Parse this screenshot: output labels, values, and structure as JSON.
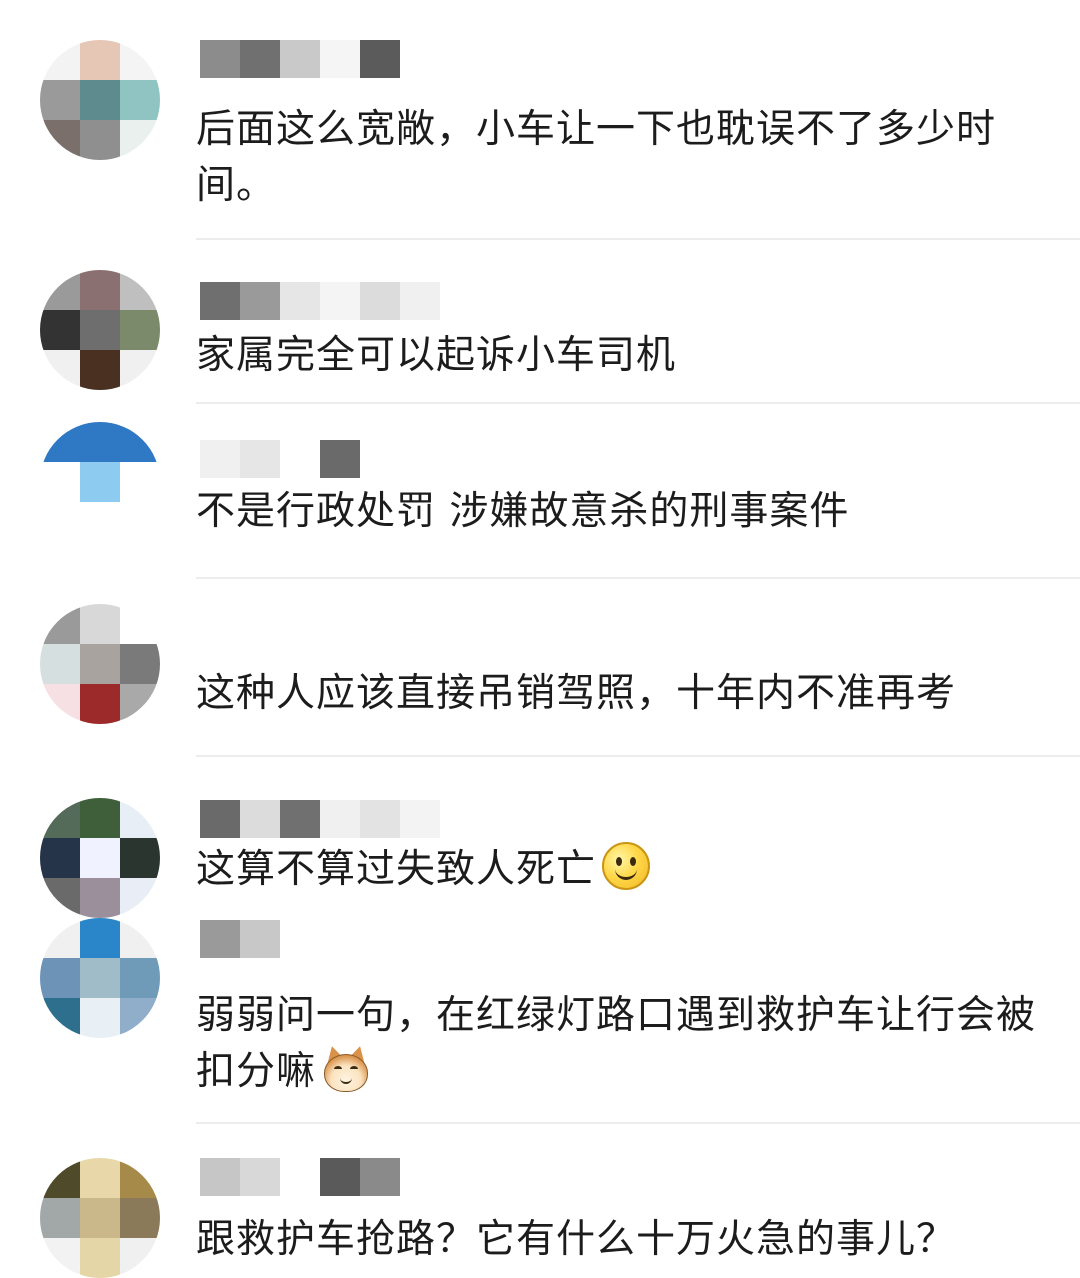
{
  "comments": [
    {
      "text": "后面这么宽敞，小车让一下也耽误不了多少时间。",
      "avatar": [
        "#f3f3f3",
        "#e6c7b5",
        "#f4f4f4",
        "#9a9a9a",
        "#5e8c8e",
        "#8fc4c2",
        "#7a6f6a",
        "#8f8f8f",
        "#e9f0ee"
      ],
      "name": [
        "#8c8c8c",
        "#707070",
        "#c9c9c9",
        "#f5f5f5",
        "#5b5b5b",
        "#ffffff"
      ]
    },
    {
      "text": "家属完全可以起诉小车司机",
      "avatar": [
        "#9a9a9a",
        "#8a7070",
        "#bfbfbf",
        "#333333",
        "#6e6e6e",
        "#7a8a6a",
        "#f0f0f0",
        "#4a3020",
        "#f0f0f0"
      ],
      "name": [
        "#6f6f6f",
        "#9a9a9a",
        "#e6e6e6",
        "#f4f4f4",
        "#dcdcdc",
        "#f0f0f0"
      ]
    },
    {
      "text": "不是行政处罚 涉嫌故意杀的刑事案件",
      "avatar": [
        "#2f78c4",
        "#2f78c4",
        "#2f78c4",
        "#ffffff",
        "#8ecbf0",
        "#ffffff",
        "#ffffff",
        "#ffffff",
        "#ffffff"
      ],
      "name": [
        "#f0f0f0",
        "#e6e6e6",
        "#ffffff",
        "#6a6a6a",
        "#ffffff",
        "#ffffff"
      ]
    },
    {
      "text": "这种人应该直接吊销驾照，十年内不准再考",
      "avatar": [
        "#9a9a9a",
        "#d8d8d8",
        "#ffffff",
        "#d6dfe0",
        "#a8a39e",
        "#7a7a7a",
        "#f6e0e4",
        "#9c2a2a",
        "#a9a9a9"
      ],
      "name": [
        "#ffffff",
        "#ffffff",
        "#ffffff",
        "#ffffff",
        "#ffffff",
        "#ffffff"
      ]
    },
    {
      "text": "这算不算过失致人死亡",
      "emoji": "smile",
      "avatar": [
        "#556b5a",
        "#3f5f3a",
        "#e8eef5",
        "#263449",
        "#f0f2ff",
        "#2a3530",
        "#6a6a6a",
        "#9a8f9a",
        "#e9eef6"
      ],
      "name": [
        "#6a6a6a",
        "#dcdcdc",
        "#707070",
        "#f0f0f0",
        "#e3e3e3",
        "#f3f3f3"
      ]
    },
    {
      "text": "弱弱问一句，在红绿灯路口遇到救护车让行会被扣分嘛",
      "emoji": "cat",
      "avatar": [
        "#f0f0f0",
        "#2a86c8",
        "#f0f0f0",
        "#6d93b7",
        "#a0bcc8",
        "#6f9ab8",
        "#2f6f8e",
        "#e8f0f6",
        "#90aeca"
      ],
      "name": [
        "#9a9a9a",
        "#c8c8c8"
      ]
    },
    {
      "text": "跟救护车抢路？它有什么十万火急的事儿？",
      "avatar": [
        "#4f4a2a",
        "#e8d7a8",
        "#a58a4a",
        "#a2a8a8",
        "#cbb88a",
        "#8a7a5a",
        "#f2f2f2",
        "#e5d6a8",
        "#f0f0f0"
      ],
      "name": [
        "#c6c6c6",
        "#d8d8d8",
        "#ffffff",
        "#5a5a5a",
        "#8a8a8a",
        "#ffffff"
      ]
    }
  ]
}
